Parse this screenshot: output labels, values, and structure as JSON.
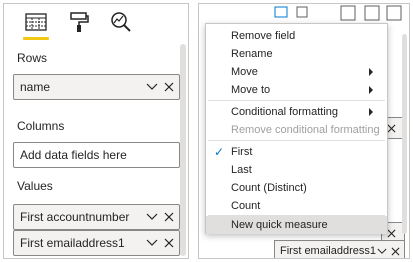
{
  "fields_pane": {
    "tabs": [
      {
        "icon": "fields-icon",
        "active": true
      },
      {
        "icon": "format-paint-roller-icon",
        "active": false
      },
      {
        "icon": "analytics-magnifier-icon",
        "active": false
      }
    ],
    "rows": {
      "title": "Rows",
      "field": "name"
    },
    "columns": {
      "title": "Columns",
      "placeholder": "Add data fields here"
    },
    "values": {
      "title": "Values",
      "fields": [
        "First accountnumber",
        "First emailaddress1"
      ]
    }
  },
  "background_pane": {
    "partial_well_label": "First emailaddress1"
  },
  "context_menu": {
    "items": [
      {
        "label": "Remove field",
        "state": "normal"
      },
      {
        "label": "Rename",
        "state": "normal"
      },
      {
        "label": "Move",
        "state": "normal",
        "submenu": true
      },
      {
        "label": "Move to",
        "state": "normal",
        "submenu": true
      },
      {
        "label": "Conditional formatting",
        "state": "normal",
        "submenu": true
      },
      {
        "label": "Remove conditional formatting",
        "state": "disabled"
      },
      {
        "label": "First",
        "state": "checked"
      },
      {
        "label": "Last",
        "state": "normal"
      },
      {
        "label": "Count (Distinct)",
        "state": "normal"
      },
      {
        "label": "Count",
        "state": "normal"
      },
      {
        "label": "New quick measure",
        "state": "highlighted"
      }
    ],
    "check_glyph": "✓"
  },
  "colors": {
    "accent_yellow": "#f2c811",
    "check_blue": "#0078d4",
    "highlight": "#e1dfdd",
    "disabled_text": "#a19f9d"
  }
}
